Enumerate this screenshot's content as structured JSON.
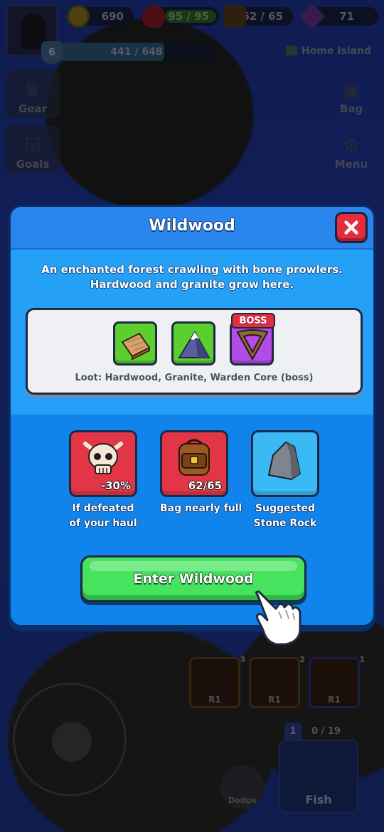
{
  "hud": {
    "coins": "690",
    "health": "95 / 95",
    "health_fraction": 1.0,
    "bag": "62 / 65",
    "gems": "71",
    "level": "6",
    "xp": "441 / 648",
    "xp_fraction": 0.68,
    "location": "Home Island"
  },
  "side_buttons": {
    "gear": "Gear",
    "goals": "Goals",
    "bag": "Bag",
    "menu": "Menu"
  },
  "skills": [
    {
      "rank": "R1",
      "count": "3"
    },
    {
      "rank": "R1",
      "count": "2"
    },
    {
      "rank": "R1",
      "count": "1"
    }
  ],
  "actions": {
    "dodge": "Dodge",
    "fish": "Fish",
    "fish_level": "1",
    "fish_progress": "0 / 19"
  },
  "modal": {
    "title": "Wildwood",
    "description_line1": "An enchanted forest crawling with bone prowlers.",
    "description_line2": "Hardwood and granite grow here.",
    "loot": [
      {
        "name": "Hardwood",
        "icon": "hardwood-icon",
        "color": "#5ccf2f"
      },
      {
        "name": "Granite",
        "icon": "granite-icon",
        "color": "#5ccf2f"
      },
      {
        "name": "Warden Core",
        "icon": "warden-core-icon",
        "color": "#b34be6",
        "tag": "BOSS"
      }
    ],
    "loot_text": "Loot: Hardwood, Granite, Warden Core (boss)",
    "stats": [
      {
        "icon": "skull-icon",
        "value": "-30%",
        "label_line1": "If defeated",
        "label_line2": "of your haul",
        "color": "#e23647"
      },
      {
        "icon": "backpack-icon",
        "value": "62/65",
        "label_line1": "Bag nearly full",
        "label_line2": "",
        "color": "#e23647"
      },
      {
        "icon": "stone-rock-icon",
        "value": "",
        "label_line1": "Suggested",
        "label_line2": "Stone Rock",
        "color": "#3ab9f5"
      }
    ],
    "enter_button": "Enter Wildwood"
  },
  "colors": {
    "modal_bg": "#0f68d8",
    "header": "#2a86ec",
    "close": "#e42c3f",
    "enter": "#47e35f"
  }
}
